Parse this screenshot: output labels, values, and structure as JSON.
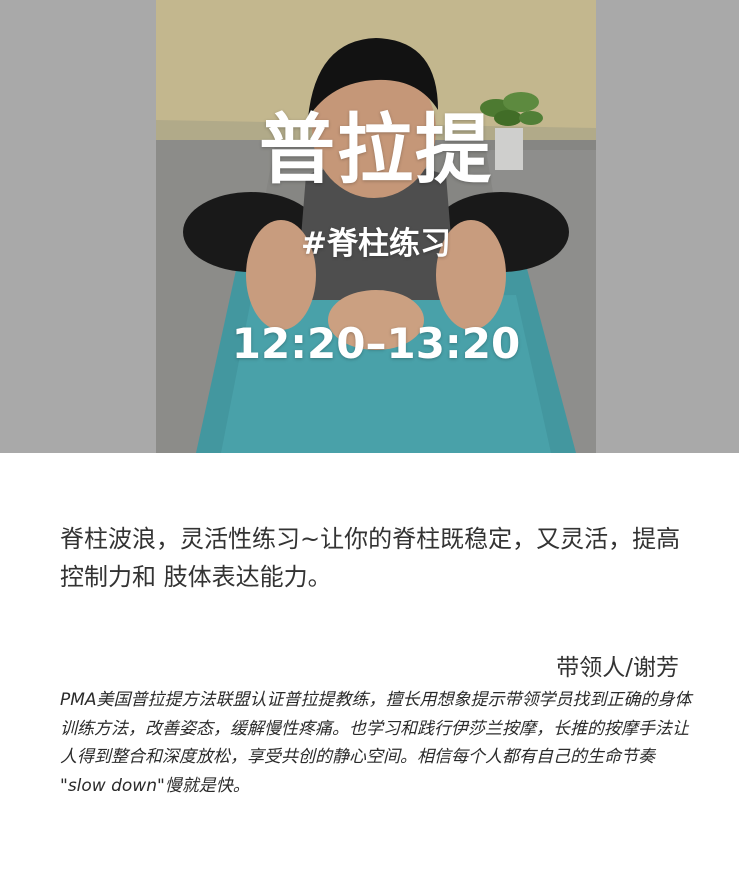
{
  "hero": {
    "title": "普拉提",
    "subtitle": "#脊柱练习",
    "time": "12:20–13:20"
  },
  "description": {
    "text": "脊柱波浪，灵活性练习~让你的脊柱既稳定，又灵活，提高控制力和 肢体表达能力。"
  },
  "instructor": {
    "label": "带领人/谢芳",
    "bio": "PMA美国普拉提方法联盟认证普拉提教练，擅长用想象提示带领学员找到正确的身体训练方法，改善姿态，缓解慢性疼痛。也学习和践行伊莎兰按摩，长推的按摩手法让人得到整合和深度放松，享受共创的静心空间。相信每个人都有自己的生命节奏 \"slow down\"慢就是快。"
  },
  "colors": {
    "band_gray": "#a9a9a9",
    "wall": "#e4d6a8",
    "floor": "#9a9a97",
    "mat": "#4fb4bd",
    "text": "#333333"
  }
}
